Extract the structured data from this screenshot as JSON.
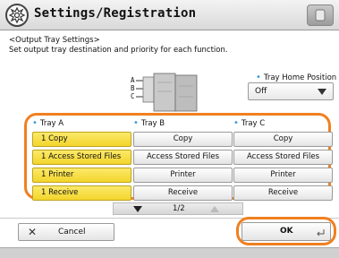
{
  "header": {
    "title": "Settings/Registration",
    "settings_icon": "settings-icon",
    "badge_icon": "help-icon"
  },
  "description": {
    "line1": "<Output Tray Settings>",
    "line2": "Set output tray destination and priority for each function."
  },
  "tray_home_position": {
    "label": "Tray Home Position",
    "value": "Off"
  },
  "machine": {
    "tray_letters": [
      "A",
      "B",
      "C"
    ]
  },
  "trays": [
    {
      "label": "Tray A",
      "functions": [
        {
          "label": "1 Copy",
          "selected": true
        },
        {
          "label": "1 Access Stored Files",
          "selected": true
        },
        {
          "label": "1 Printer",
          "selected": true
        },
        {
          "label": "1 Receive",
          "selected": true
        }
      ]
    },
    {
      "label": "Tray B",
      "functions": [
        {
          "label": "Copy",
          "selected": false
        },
        {
          "label": "Access Stored Files",
          "selected": false
        },
        {
          "label": "Printer",
          "selected": false
        },
        {
          "label": "Receive",
          "selected": false
        }
      ]
    },
    {
      "label": "Tray C",
      "functions": [
        {
          "label": "Copy",
          "selected": false
        },
        {
          "label": "Access Stored Files",
          "selected": false
        },
        {
          "label": "Printer",
          "selected": false
        },
        {
          "label": "Receive",
          "selected": false
        }
      ]
    }
  ],
  "pager": {
    "page": "1/2"
  },
  "actions": {
    "cancel_label": "Cancel",
    "ok_label": "OK"
  },
  "colors": {
    "highlight": "#f08020",
    "selected": "#f3d52c",
    "accent_dot": "#3a9ad9"
  }
}
